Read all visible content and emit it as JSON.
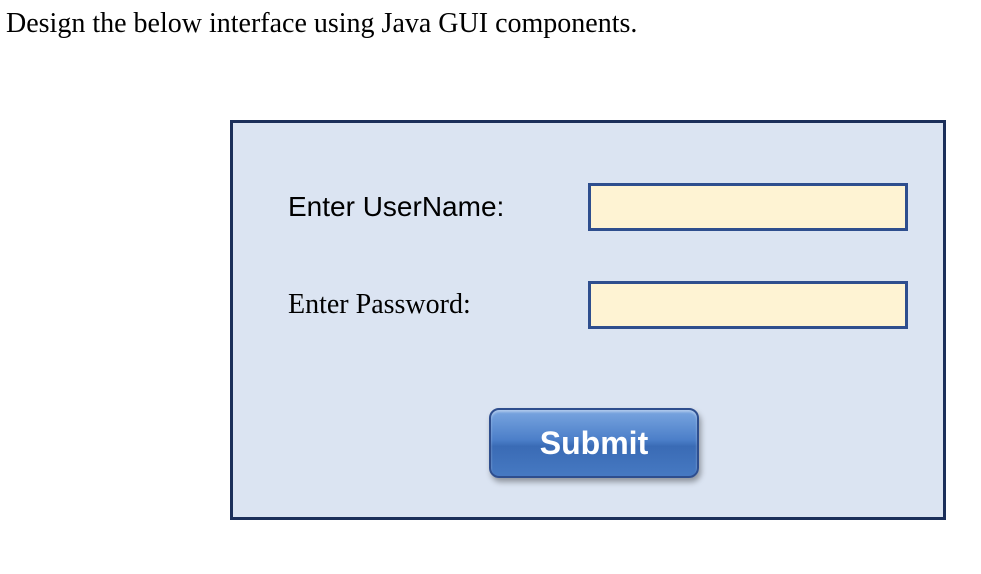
{
  "instruction": "Design the below interface using Java GUI components.",
  "form": {
    "username": {
      "label": "Enter UserName:",
      "value": ""
    },
    "password": {
      "label": "Enter Password:",
      "value": ""
    },
    "submit_label": "Submit"
  }
}
